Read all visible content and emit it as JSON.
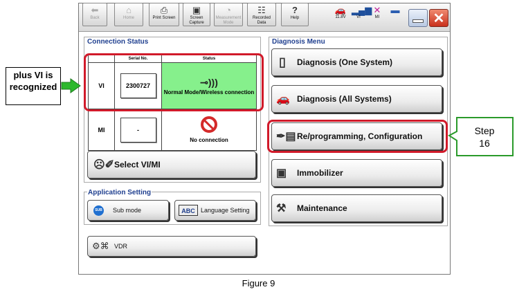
{
  "toolbar": {
    "buttons": [
      {
        "label": "Back",
        "icon": "back-arrow-icon",
        "enabled": false
      },
      {
        "label": "Home",
        "icon": "home-icon",
        "enabled": false
      },
      {
        "label": "Print Screen",
        "icon": "printer-icon",
        "enabled": true
      },
      {
        "label": "Screen Capture",
        "icon": "camera-icon",
        "enabled": true
      },
      {
        "label": "Measurement Mode",
        "icon": "meter-icon",
        "enabled": false
      },
      {
        "label": "Recorded Data",
        "icon": "recorded-data-icon",
        "enabled": true
      },
      {
        "label": "Help",
        "icon": "help-icon",
        "enabled": true
      }
    ],
    "status": {
      "voltage": "11.8V",
      "vi_label": "VI",
      "mi_label": "MI"
    }
  },
  "connection_status": {
    "title": "Connection Status",
    "col_serial": "Serial No.",
    "col_status": "Status",
    "rows": [
      {
        "name": "VI",
        "serial": "2300727",
        "status": "Normal Mode/Wireless connection",
        "icon": "wireless-connection-icon",
        "color": "#86f08c"
      },
      {
        "name": "MI",
        "serial": "-",
        "status": "No connection",
        "icon": "no-connection-icon",
        "color": "#ffffff"
      }
    ]
  },
  "select_button": {
    "label": "Select VI/MI"
  },
  "application_setting": {
    "title": "Application Setting",
    "sub_mode": "Sub mode",
    "sub_mode_badge": "SUB",
    "language": "Language Setting",
    "language_badge": "ABC"
  },
  "vdr": {
    "label": "VDR"
  },
  "diagnosis_menu": {
    "title": "Diagnosis Menu",
    "items": [
      {
        "label": "Diagnosis (One System)"
      },
      {
        "label": "Diagnosis (All Systems)"
      },
      {
        "label": "Re/programming, Configuration"
      },
      {
        "label": "Immobilizer"
      },
      {
        "label": "Maintenance"
      }
    ]
  },
  "annotations": {
    "left_callout": "plus VI is recognized",
    "right_callout_1": "Step",
    "right_callout_2": "16",
    "caption": "Figure 9",
    "highlight_color": "#d11a2a",
    "arrow_color": "#2db82d"
  }
}
